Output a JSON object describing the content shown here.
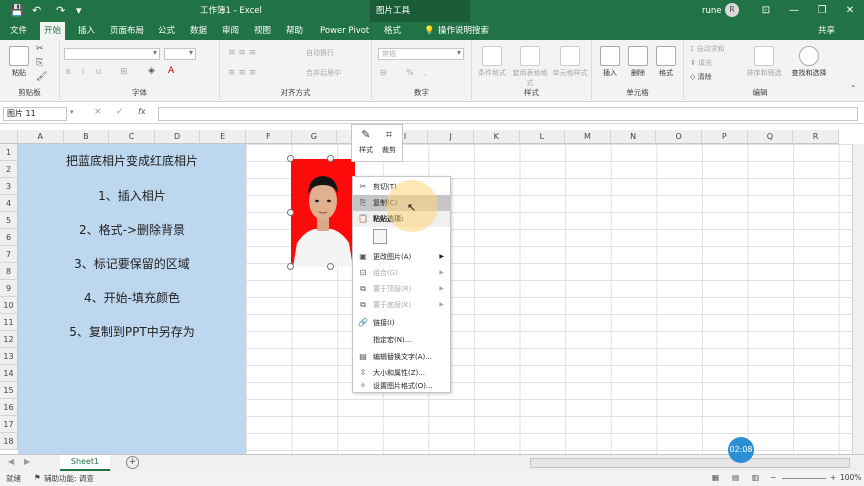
{
  "titlebar": {
    "title": "工作簿1 - Excel",
    "tool_title": "图片工具",
    "user": "rune",
    "avatar_letter": "R",
    "save_glyph": "💾",
    "undo_glyph": "↶",
    "redo_glyph": "↷",
    "qa_more_glyph": "▾",
    "ribbon_options_glyph": "⊡",
    "min_glyph": "—",
    "restore_glyph": "❐",
    "close_glyph": "✕"
  },
  "tabs": [
    "文件",
    "开始",
    "插入",
    "页面布局",
    "公式",
    "数据",
    "审阅",
    "视图",
    "帮助",
    "Power Pivot",
    "格式"
  ],
  "active_tab_index": 1,
  "tell_me": "操作说明搜索",
  "share": "共享",
  "ribbon": {
    "clipboard": {
      "paste": "粘贴",
      "label": "剪贴板"
    },
    "font": {
      "bold": "B",
      "italic": "I",
      "underline": "U",
      "label": "字体"
    },
    "alignment": {
      "wrap": "自动换行",
      "merge": "合并后居中",
      "label": "对齐方式"
    },
    "number": {
      "format": "常规",
      "pct": "%",
      "comma": ",",
      "label": "数字"
    },
    "styles": {
      "cond": "条件格式",
      "table": "套用表格格式",
      "cell": "单元格样式",
      "label": "样式"
    },
    "cells": {
      "insert": "插入",
      "delete": "删除",
      "format": "格式",
      "label": "单元格"
    },
    "editing": {
      "autosum": "自动求和",
      "fill": "填充",
      "clear": "清除",
      "sort": "排序和筛选",
      "find": "查找和选择",
      "label": "编辑"
    }
  },
  "formula_bar": {
    "name_box": "图片 11",
    "fx": "fx",
    "cancel": "×",
    "enter": "✓"
  },
  "columns": [
    "A",
    "B",
    "C",
    "D",
    "E",
    "F",
    "G",
    "H",
    "I",
    "J",
    "K",
    "L",
    "M",
    "N",
    "O",
    "P",
    "Q",
    "R"
  ],
  "rows": [
    "1",
    "2",
    "3",
    "4",
    "5",
    "6",
    "7",
    "8",
    "9",
    "10",
    "11",
    "12",
    "13",
    "14",
    "15",
    "16",
    "17",
    "18"
  ],
  "steps": [
    "把蓝底相片变成红底相片",
    "1、插入相片",
    "2、格式->删除背景",
    "3、标记要保留的区域",
    "4、开始-填充颜色",
    "5、复制到PPT中另存为"
  ],
  "mini_toolbar": {
    "style": "样式",
    "crop": "裁剪"
  },
  "context_menu": {
    "cut": "剪切(T)",
    "copy": "复制(C)",
    "paste_options": "粘贴选项:",
    "change_picture": "更改图片(A)",
    "group": "组合(G)",
    "bring_front": "置于顶层(R)",
    "send_back": "置于底层(K)",
    "link": "链接(I)",
    "assign_macro": "指定宏(N)...",
    "edit_alt": "编辑替换文字(A)...",
    "size_props": "大小和属性(Z)...",
    "format_picture": "设置图片格式(O)..."
  },
  "sheet": {
    "tab": "Sheet1",
    "add": "+"
  },
  "timer": "02:08",
  "status": {
    "ready": "就绪",
    "accessibility": "辅助功能: 调查",
    "zoom": "100%"
  },
  "colors": {
    "excel_green": "#217346",
    "blue_fill": "#bcd7ee",
    "photo_red": "#ff0a0a"
  }
}
